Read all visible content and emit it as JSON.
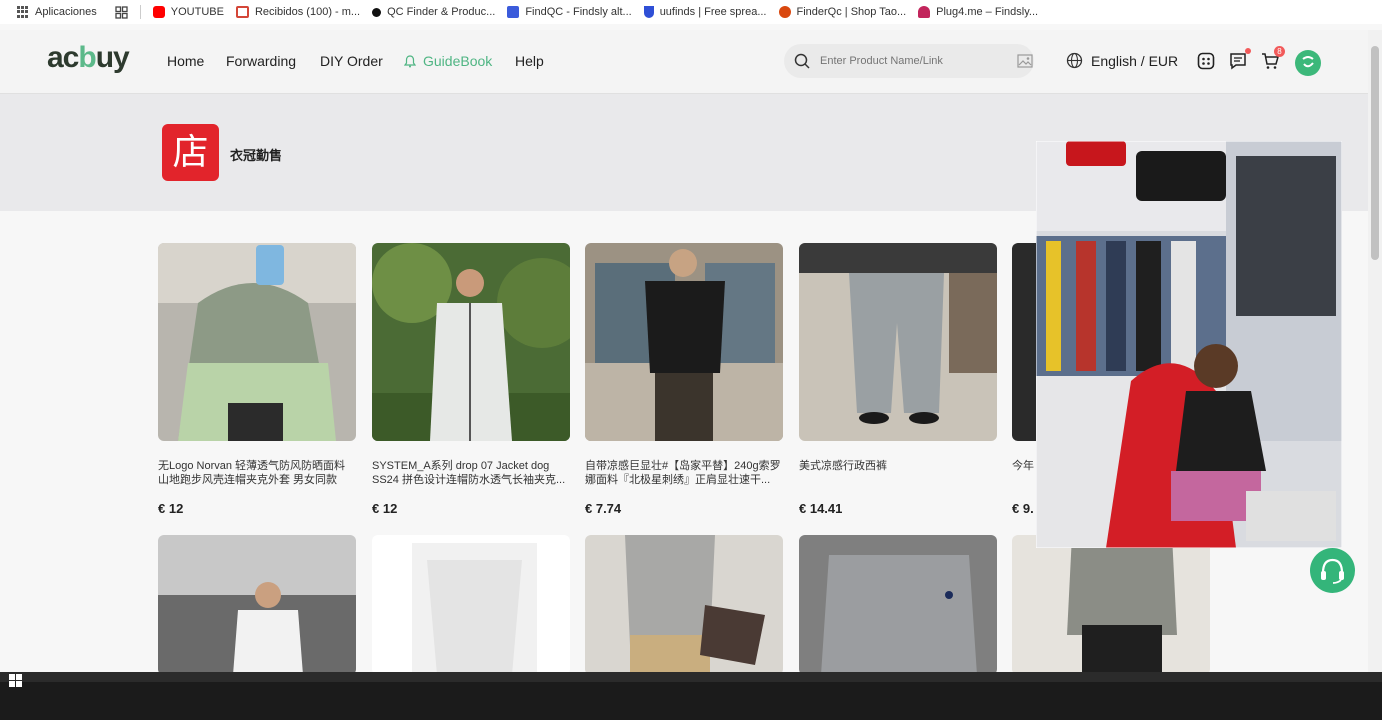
{
  "bookmarks": [
    {
      "label": "Aplicaciones",
      "icon": "apps-grid-icon"
    },
    {
      "label": "",
      "icon": "tab-groups-icon"
    },
    {
      "label": "YOUTUBE",
      "icon": "youtube-icon",
      "color": "#ff0000"
    },
    {
      "label": "Recibidos (100) - m...",
      "icon": "gmail-icon",
      "color": "#d44638"
    },
    {
      "label": "QC Finder & Produc...",
      "icon": "qcfinder-icon",
      "color": "#111111"
    },
    {
      "label": "FindQC - Findsly alt...",
      "icon": "findqc-icon",
      "color": "#3b5bdb"
    },
    {
      "label": "uufinds | Free sprea...",
      "icon": "uufinds-icon",
      "color": "#2f4fd6"
    },
    {
      "label": "FinderQc | Shop Tao...",
      "icon": "finderqc-icon",
      "color": "#d9480f"
    },
    {
      "label": "Plug4.me – Findsly...",
      "icon": "plug4me-icon",
      "color": "#c2255c"
    }
  ],
  "header": {
    "logo_left": "ac",
    "logo_mid": "b",
    "logo_right": "uy",
    "nav": [
      {
        "label": "Home"
      },
      {
        "label": "Forwarding"
      },
      {
        "label": "DIY Order"
      },
      {
        "label": "GuideBook"
      },
      {
        "label": "Help"
      }
    ],
    "search_placeholder": "Enter Product Name/Link",
    "language": "English / EUR",
    "cart_count": "8",
    "accent": "#4fb583"
  },
  "store": {
    "logo_char": "店",
    "name": "衣冠勤售"
  },
  "products": [
    {
      "title": "无Logo Norvan 轻薄透气防风防晒面料山地跑步风壳连帽夹克外套 男女同款",
      "price": "€ 12"
    },
    {
      "title": "SYSTEM_A系列 drop 07 Jacket dog SS24 拼色设计连帽防水透气长袖夹克...",
      "price": "€ 12"
    },
    {
      "title": "自带凉感巨显壮#【岛家平替】240g索罗娜面料『北极星刺绣』正肩显壮速干...",
      "price": "€ 7.74"
    },
    {
      "title": "美式凉感行政西裤",
      "price": "€ 14.41"
    },
    {
      "title": "今年",
      "price": "€ 9."
    }
  ]
}
